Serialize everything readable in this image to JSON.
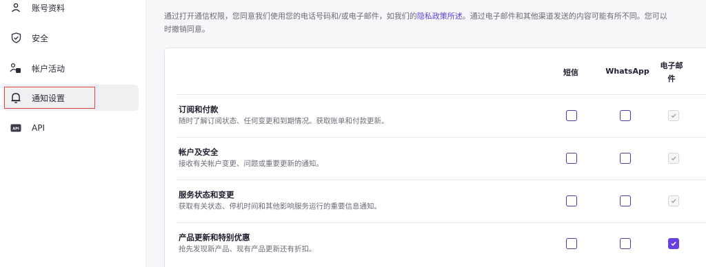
{
  "sidebar": {
    "items": [
      {
        "label": "账号资料",
        "icon": "user-icon"
      },
      {
        "label": "安全",
        "icon": "shield-icon"
      },
      {
        "label": "帐户活动",
        "icon": "activity-icon"
      },
      {
        "label": "通知设置",
        "icon": "bell-icon"
      },
      {
        "label": "API",
        "icon": "api-icon"
      }
    ]
  },
  "intro": {
    "text_before": "通过打开通信权限，您同意我们使用您的电话号码和/或电子邮件，如我们的",
    "link": "隐私政策所述",
    "text_after": "。通过电子邮件和其他渠道发送的内容可能有所不同。您可以",
    "line2": "时撤销同意。"
  },
  "table": {
    "columns": {
      "sms": "短信",
      "whatsapp": "WhatsApp",
      "email_line1": "电子邮",
      "email_line2": "件"
    },
    "rows": [
      {
        "title": "订阅和付款",
        "desc": "随时了解订阅状态、任何变更和到期情况。获取账单和付款更新。",
        "sms": false,
        "whatsapp": false,
        "email": "checked-disabled"
      },
      {
        "title": "帐户及安全",
        "desc": "接收有关帐户变更、问题或重要更新的通知。",
        "sms": false,
        "whatsapp": false,
        "email": "checked-disabled"
      },
      {
        "title": "服务状态和变更",
        "desc": "获取有关状态、停机时间和其他影响服务运行的重要信息通知。",
        "sms": false,
        "whatsapp": false,
        "email": "checked-disabled"
      },
      {
        "title": "产品更新和特别优惠",
        "desc": "抢先发现新产品、现有产品更新还有折扣。",
        "sms": false,
        "whatsapp": false,
        "email": "checked"
      }
    ]
  },
  "colors": {
    "accent": "#6a3fe0",
    "link": "#5b3fd8",
    "highlight_outline": "#e0443e"
  }
}
